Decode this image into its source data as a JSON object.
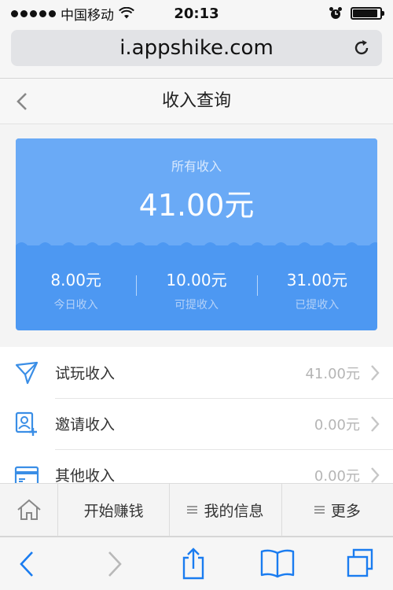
{
  "status_bar": {
    "carrier": "中国移动",
    "time": "20:13"
  },
  "browser": {
    "url": "i.appshike.com"
  },
  "nav": {
    "title": "收入查询"
  },
  "summary": {
    "label": "所有收入",
    "amount": "41.00元",
    "stats": [
      {
        "value": "8.00元",
        "label": "今日收入"
      },
      {
        "value": "10.00元",
        "label": "可提收入"
      },
      {
        "value": "31.00元",
        "label": "已提收入"
      }
    ]
  },
  "income_list": [
    {
      "icon": "send-icon",
      "label": "试玩收入",
      "value": "41.00元"
    },
    {
      "icon": "add-user-icon",
      "label": "邀请收入",
      "value": "0.00元"
    },
    {
      "icon": "card-icon",
      "label": "其他收入",
      "value": "0.00元"
    }
  ],
  "menu": {
    "items": [
      "开始赚钱",
      "我的信息",
      "更多"
    ]
  },
  "colors": {
    "card_top": "#6aaaf6",
    "card_bottom": "#4d98f2",
    "accent": "#3a8ee6",
    "ios_blue": "#1a7cf0"
  }
}
